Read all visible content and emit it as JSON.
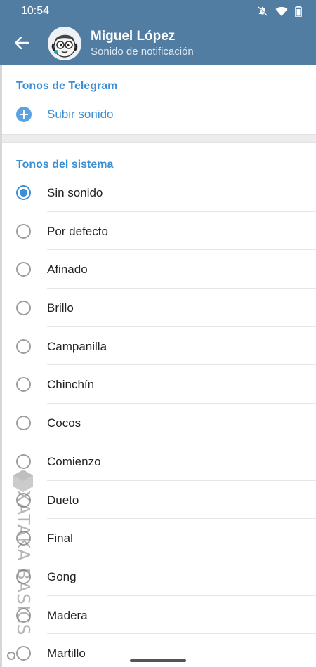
{
  "status_bar": {
    "time": "10:54",
    "icons": [
      "bell-off-icon",
      "wifi-icon",
      "battery-icon"
    ]
  },
  "app_bar": {
    "title": "Miguel López",
    "subtitle": "Sonido de notificación",
    "back_icon": "arrow-left-icon"
  },
  "telegram_tones": {
    "header": "Tonos de Telegram",
    "upload_label": "Subir sonido"
  },
  "system_tones": {
    "header": "Tonos del sistema",
    "items": [
      {
        "label": "Sin sonido",
        "selected": true
      },
      {
        "label": "Por defecto",
        "selected": false
      },
      {
        "label": "Afinado",
        "selected": false
      },
      {
        "label": "Brillo",
        "selected": false
      },
      {
        "label": "Campanilla",
        "selected": false
      },
      {
        "label": "Chinchín",
        "selected": false
      },
      {
        "label": "Cocos",
        "selected": false
      },
      {
        "label": "Comienzo",
        "selected": false
      },
      {
        "label": "Dueto",
        "selected": false
      },
      {
        "label": "Final",
        "selected": false
      },
      {
        "label": "Gong",
        "selected": false
      },
      {
        "label": "Madera",
        "selected": false
      },
      {
        "label": "Martillo",
        "selected": false
      }
    ]
  },
  "watermark": "XATAKA BASICS",
  "colors": {
    "app_bar": "#527da3",
    "accent": "#3d8fd4"
  }
}
